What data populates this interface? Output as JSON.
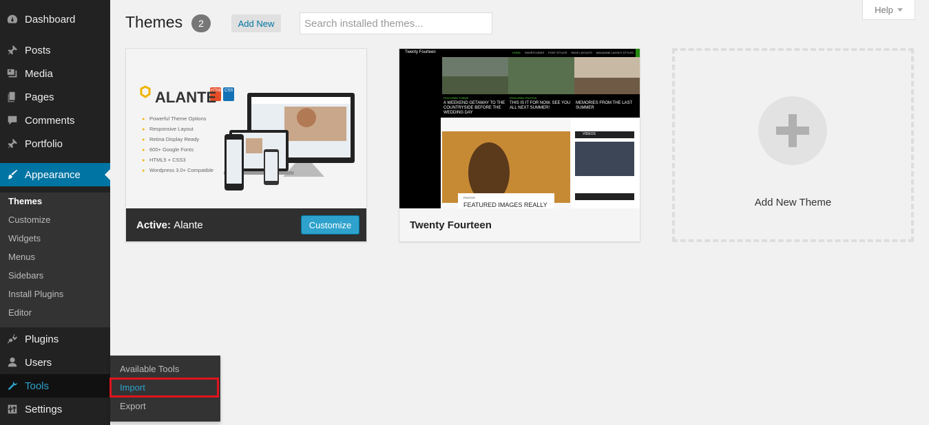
{
  "sidebar": {
    "items": [
      {
        "label": "Dashboard",
        "icon": "dashboard-icon"
      },
      {
        "label": "Posts",
        "icon": "pin-icon"
      },
      {
        "label": "Media",
        "icon": "media-icon"
      },
      {
        "label": "Pages",
        "icon": "pages-icon"
      },
      {
        "label": "Comments",
        "icon": "comment-icon"
      },
      {
        "label": "Portfolio",
        "icon": "pin-icon"
      },
      {
        "label": "Appearance",
        "icon": "brush-icon"
      },
      {
        "label": "Plugins",
        "icon": "plugin-icon"
      },
      {
        "label": "Users",
        "icon": "user-icon"
      },
      {
        "label": "Tools",
        "icon": "wrench-icon"
      },
      {
        "label": "Settings",
        "icon": "settings-icon"
      }
    ],
    "appearance_submenu": [
      "Themes",
      "Customize",
      "Widgets",
      "Menus",
      "Sidebars",
      "Install Plugins",
      "Editor"
    ],
    "tools_flyout": [
      "Available Tools",
      "Import",
      "Export"
    ]
  },
  "header": {
    "title": "Themes",
    "count": "2",
    "add_new": "Add New",
    "search_placeholder": "Search installed themes...",
    "help": "Help"
  },
  "themes": [
    {
      "active_prefix": "Active:",
      "name": "Alante",
      "customize": "Customize",
      "screenshot": {
        "logo": "ALANTE",
        "badges": [
          "HTML",
          "CSS"
        ],
        "features": [
          "Powerful Theme Options",
          "Responsive Layout",
          "Retina Display Ready",
          "600+ Google Fonts",
          "HTML5 + CSS3",
          "Wordpress 3.0+ Compatible"
        ]
      }
    },
    {
      "name": "Twenty Fourteen",
      "screenshot": {
        "site_title": "Twenty Fourteen",
        "nav": [
          "HOME",
          "SHORTCODES",
          "POST STYLES",
          "PAGE LAYOUTS",
          "MAGAZINE LAYOUT STYLES"
        ],
        "captions": [
          "A WEEKEND GETAWAY TO THE COUNTRYSIDE BEFORE THE WEDDING DAY",
          "THIS IS IT FOR NOW. SEE YOU ALL NEXT SUMMER!",
          "MEMORIES FROM THE LAST SUMMER"
        ],
        "tags": [
          "FEATURED THEME",
          "FEATURED PHOTOS"
        ],
        "featured": "FEATURED IMAGES REALLY",
        "photo_tag": "PHOTOS",
        "video_label": "VIDEOS"
      }
    }
  ],
  "add_new_theme": "Add New Theme",
  "colors": {
    "sidebar": "#222222",
    "active": "#0074a2",
    "accent": "#2ea2cc",
    "highlight_box": "#e0141e"
  }
}
